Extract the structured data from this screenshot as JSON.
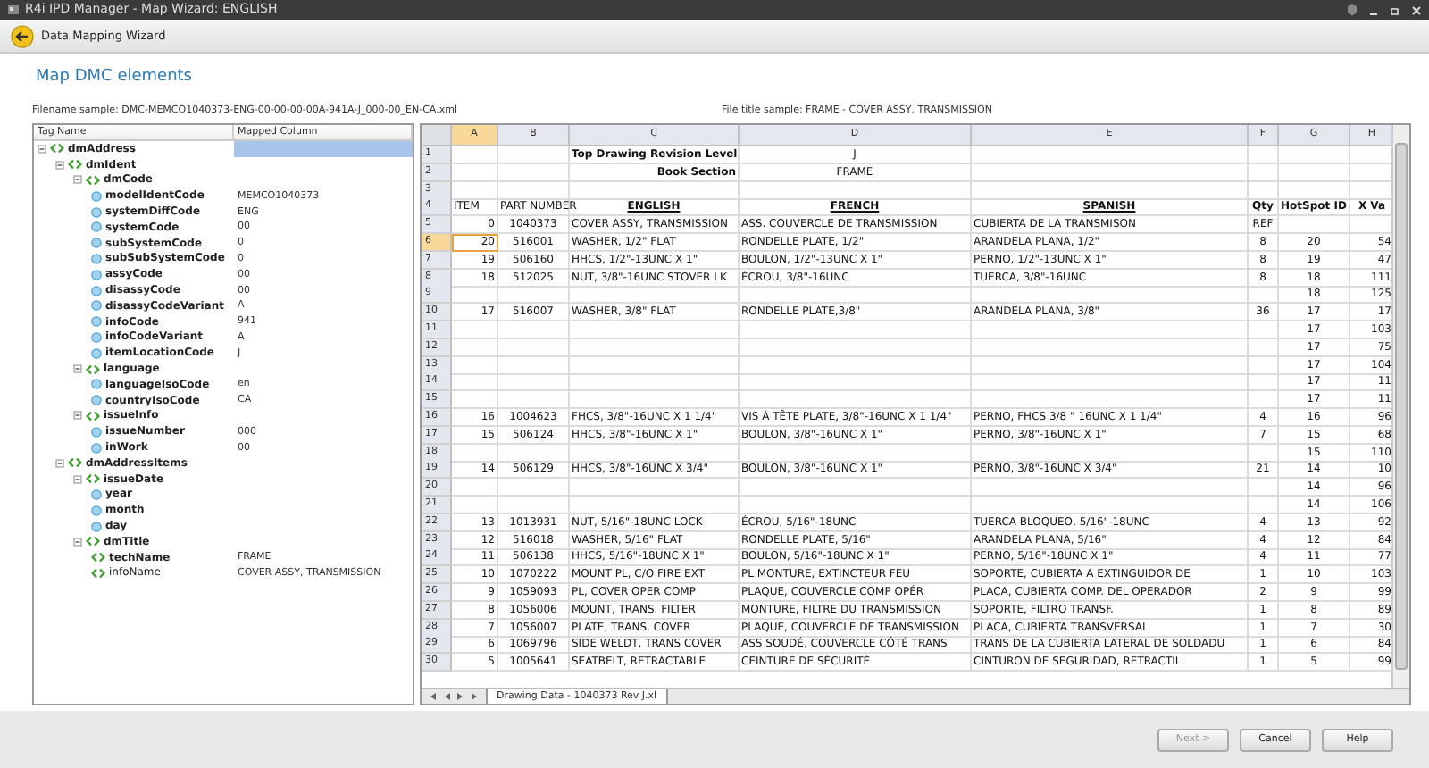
{
  "window": {
    "title": "R4i IPD Manager - Map Wizard: ENGLISH"
  },
  "toolbar": {
    "title": "Data Mapping Wizard"
  },
  "heading": "Map DMC elements",
  "filename_sample": "Filename sample: DMC-MEMCO1040373-ENG-00-00-00-00A-941A-J_000-00_EN-CA.xml",
  "file_title_sample": "File title sample: FRAME - COVER ASSY, TRANSMISSION",
  "tree": {
    "columns": [
      "Tag Name",
      "Mapped Column"
    ],
    "nodes": [
      {
        "name": "dmAddress",
        "kind": "element",
        "selected": true,
        "expanded": true,
        "children": [
          {
            "name": "dmIdent",
            "kind": "element",
            "selected": false,
            "expanded": true,
            "children": [
              {
                "name": "dmCode",
                "kind": "element",
                "selected": false,
                "expanded": true,
                "children": [
                  {
                    "name": "modelIdentCode",
                    "kind": "attribute",
                    "value": "MEMCO1040373",
                    "selected": false
                  },
                  {
                    "name": "systemDiffCode",
                    "kind": "attribute",
                    "value": "ENG",
                    "selected": false
                  },
                  {
                    "name": "systemCode",
                    "kind": "attribute",
                    "value": "00",
                    "selected": false
                  },
                  {
                    "name": "subSystemCode",
                    "kind": "attribute",
                    "value": "0",
                    "selected": false
                  },
                  {
                    "name": "subSubSystemCode",
                    "kind": "attribute",
                    "value": "0",
                    "selected": false
                  },
                  {
                    "name": "assyCode",
                    "kind": "attribute",
                    "value": "00",
                    "selected": false
                  },
                  {
                    "name": "disassyCode",
                    "kind": "attribute",
                    "value": "00",
                    "selected": false
                  },
                  {
                    "name": "disassyCodeVariant",
                    "kind": "attribute",
                    "value": "A",
                    "selected": false
                  },
                  {
                    "name": "infoCode",
                    "kind": "attribute",
                    "value": "941",
                    "selected": false
                  },
                  {
                    "name": "infoCodeVariant",
                    "kind": "attribute",
                    "value": "A",
                    "selected": false
                  },
                  {
                    "name": "itemLocationCode",
                    "kind": "attribute",
                    "value": "J",
                    "selected": false
                  }
                ]
              },
              {
                "name": "language",
                "kind": "element",
                "selected": false,
                "expanded": true,
                "children": [
                  {
                    "name": "languageIsoCode",
                    "kind": "attribute",
                    "value": "en",
                    "selected": false
                  },
                  {
                    "name": "countryIsoCode",
                    "kind": "attribute",
                    "value": "CA",
                    "selected": false
                  }
                ]
              },
              {
                "name": "issueInfo",
                "kind": "element",
                "selected": false,
                "expanded": true,
                "children": [
                  {
                    "name": "issueNumber",
                    "kind": "attribute",
                    "value": "000",
                    "selected": false
                  },
                  {
                    "name": "inWork",
                    "kind": "attribute",
                    "value": "00",
                    "selected": false
                  }
                ]
              }
            ]
          },
          {
            "name": "dmAddressItems",
            "kind": "element",
            "selected": false,
            "expanded": true,
            "children": [
              {
                "name": "issueDate",
                "kind": "element",
                "selected": false,
                "expanded": true,
                "children": [
                  {
                    "name": "year",
                    "kind": "attribute",
                    "selected": false
                  },
                  {
                    "name": "month",
                    "kind": "attribute",
                    "selected": false
                  },
                  {
                    "name": "day",
                    "kind": "attribute",
                    "selected": false
                  }
                ]
              },
              {
                "name": "dmTitle",
                "kind": "element",
                "selected": false,
                "expanded": true,
                "children": [
                  {
                    "name": "techName",
                    "kind": "element",
                    "value": "FRAME",
                    "selected": false
                  },
                  {
                    "name": "infoName",
                    "kind": "element",
                    "value": "COVER ASSY, TRANSMISSION",
                    "bold": false,
                    "selected": false
                  }
                ]
              }
            ]
          }
        ]
      }
    ]
  },
  "sheet": {
    "columns": [
      {
        "label": "A",
        "selected": true
      },
      {
        "label": "B",
        "selected": false
      },
      {
        "label": "C",
        "selected": false
      },
      {
        "label": "D",
        "selected": false
      },
      {
        "label": "E",
        "selected": false
      },
      {
        "label": "F",
        "selected": false
      },
      {
        "label": "G",
        "selected": false
      },
      {
        "label": "H",
        "selected": false
      }
    ],
    "rows": [
      {
        "number": "1",
        "kind": "title",
        "selected": false,
        "cells": [
          "",
          "",
          "Top Drawing Revision Level",
          "J",
          "",
          "",
          "",
          ""
        ]
      },
      {
        "number": "2",
        "kind": "title",
        "selected": false,
        "cells": [
          "",
          "",
          "Book Section",
          "FRAME",
          "",
          "",
          "",
          ""
        ]
      },
      {
        "number": "3",
        "kind": "data",
        "selected": false,
        "cells": [
          "",
          "",
          "",
          "",
          "",
          "",
          "",
          ""
        ]
      },
      {
        "number": "4",
        "kind": "heading",
        "selected": false,
        "cells": [
          "ITEM",
          "PART NUMBER",
          "ENGLISH",
          "FRENCH",
          "SPANISH",
          "Qty",
          "HotSpot ID",
          "X Va"
        ]
      },
      {
        "number": "5",
        "kind": "data",
        "selected": false,
        "cells": [
          "0",
          "1040373",
          "COVER ASSY, TRANSMISSION",
          "ASS. COUVERCLE DE TRANSMISSION",
          "CUBIERTA DE LA TRANSMISON",
          "REF",
          "",
          ""
        ]
      },
      {
        "number": "6",
        "kind": "data",
        "selected": true,
        "cells": [
          "20",
          "516001",
          "WASHER, 1/2\" FLAT",
          "RONDELLE PLATE, 1/2\"",
          "ARANDELA PLANA, 1/2\"",
          "8",
          "20",
          "54"
        ]
      },
      {
        "number": "7",
        "kind": "data",
        "selected": false,
        "cells": [
          "19",
          "506160",
          "HHCS, 1/2\"-13UNC X 1\"",
          "BOULON, 1/2\"-13UNC X 1\"",
          "PERNO, 1/2\"-13UNC X 1\"",
          "8",
          "19",
          "47"
        ]
      },
      {
        "number": "8",
        "kind": "data",
        "selected": false,
        "cells": [
          "18",
          "512025",
          "NUT, 3/8\"-16UNC STOVER LK",
          "ÉCROU, 3/8\"-16UNC",
          "TUERCA, 3/8\"-16UNC",
          "8",
          "18",
          "111"
        ]
      },
      {
        "number": "9",
        "kind": "data",
        "selected": false,
        "cells": [
          "",
          "",
          "",
          "",
          "",
          "",
          "18",
          "125"
        ]
      },
      {
        "number": "10",
        "kind": "data",
        "selected": false,
        "cells": [
          "17",
          "516007",
          "WASHER, 3/8\" FLAT",
          "RONDELLE PLATE,3/8\"",
          "ARANDELA PLANA, 3/8\"",
          "36",
          "17",
          "17"
        ]
      },
      {
        "number": "11",
        "kind": "data",
        "selected": false,
        "cells": [
          "",
          "",
          "",
          "",
          "",
          "",
          "17",
          "103"
        ]
      },
      {
        "number": "12",
        "kind": "data",
        "selected": false,
        "cells": [
          "",
          "",
          "",
          "",
          "",
          "",
          "17",
          "75"
        ]
      },
      {
        "number": "13",
        "kind": "data",
        "selected": false,
        "cells": [
          "",
          "",
          "",
          "",
          "",
          "",
          "17",
          "104"
        ]
      },
      {
        "number": "14",
        "kind": "data",
        "selected": false,
        "cells": [
          "",
          "",
          "",
          "",
          "",
          "",
          "17",
          "11"
        ]
      },
      {
        "number": "15",
        "kind": "data",
        "selected": false,
        "cells": [
          "",
          "",
          "",
          "",
          "",
          "",
          "17",
          "11"
        ]
      },
      {
        "number": "16",
        "kind": "data",
        "selected": false,
        "cells": [
          "16",
          "1004623",
          "FHCS, 3/8\"-16UNC X 1 1/4\"",
          "VIS À TÊTE PLATE, 3/8\"-16UNC X 1 1/4\"",
          "PERNO, FHCS 3/8 \" 16UNC X 1 1/4\"",
          "4",
          "16",
          "96"
        ]
      },
      {
        "number": "17",
        "kind": "data",
        "selected": false,
        "cells": [
          "15",
          "506124",
          "HHCS, 3/8\"-16UNC X 1\"",
          "BOULON, 3/8\"-16UNC X 1\"",
          "PERNO, 3/8\"-16UNC X 1\"",
          "7",
          "15",
          "68"
        ]
      },
      {
        "number": "18",
        "kind": "data",
        "selected": false,
        "cells": [
          "",
          "",
          "",
          "",
          "",
          "",
          "15",
          "110"
        ]
      },
      {
        "number": "19",
        "kind": "data",
        "selected": false,
        "cells": [
          "14",
          "506129",
          "HHCS, 3/8\"-16UNC X 3/4\"",
          "BOULON, 3/8\"-16UNC X 1\"",
          "PERNO, 3/8\"-16UNC X 3/4\"",
          "21",
          "14",
          "10"
        ]
      },
      {
        "number": "20",
        "kind": "data",
        "selected": false,
        "cells": [
          "",
          "",
          "",
          "",
          "",
          "",
          "14",
          "96"
        ]
      },
      {
        "number": "21",
        "kind": "data",
        "selected": false,
        "cells": [
          "",
          "",
          "",
          "",
          "",
          "",
          "14",
          "106"
        ]
      },
      {
        "number": "22",
        "kind": "data",
        "selected": false,
        "cells": [
          "13",
          "1013931",
          "NUT, 5/16\"-18UNC LOCK",
          "ÉCROU, 5/16\"-18UNC",
          "TUERCA BLOQUEO, 5/16\"-18UNC",
          "4",
          "13",
          "92"
        ]
      },
      {
        "number": "23",
        "kind": "data",
        "selected": false,
        "cells": [
          "12",
          "516018",
          "WASHER, 5/16\" FLAT",
          "RONDELLE PLATE, 5/16\"",
          "ARANDELA PLANA, 5/16\"",
          "4",
          "12",
          "84"
        ]
      },
      {
        "number": "24",
        "kind": "data",
        "selected": false,
        "cells": [
          "11",
          "506138",
          "HHCS, 5/16\"-18UNC X 1\"",
          "BOULON, 5/16\"-18UNC X 1\"",
          "PERNO, 5/16\"-18UNC X 1\"",
          "4",
          "11",
          "77"
        ]
      },
      {
        "number": "25",
        "kind": "data",
        "selected": false,
        "cells": [
          "10",
          "1070222",
          "MOUNT PL, C/O FIRE EXT",
          "PL MONTURE, EXTINCTEUR FEU",
          "SOPORTE, CUBIERTA A EXTINGUIDOR DE",
          "1",
          "10",
          "103"
        ]
      },
      {
        "number": "26",
        "kind": "data",
        "selected": false,
        "cells": [
          "9",
          "1059093",
          "PL, COVER OPER COMP",
          "PLAQUE, COUVERCLE COMP OPÉR",
          "PLACA, CUBIERTA COMP. DEL OPERADOR",
          "2",
          "9",
          "99"
        ]
      },
      {
        "number": "27",
        "kind": "data",
        "selected": false,
        "cells": [
          "8",
          "1056006",
          "MOUNT, TRANS. FILTER",
          "MONTURE, FILTRE DU TRANSMISSION",
          "SOPORTE, FILTRO TRANSF.",
          "1",
          "8",
          "89"
        ]
      },
      {
        "number": "28",
        "kind": "data",
        "selected": false,
        "cells": [
          "7",
          "1056007",
          "PLATE, TRANS. COVER",
          "PLAQUE, COUVERCLE DE TRANSMISSION",
          "PLACA, CUBIERTA TRANSVERSAL",
          "1",
          "7",
          "30"
        ]
      },
      {
        "number": "29",
        "kind": "data",
        "selected": false,
        "cells": [
          "6",
          "1069796",
          "SIDE WELDT, TRANS COVER",
          "ASS SOUDÉ, COUVERCLE CÔTÉ TRANS",
          "TRANS DE LA CUBIERTA LATERAL DE SOLDADU",
          "1",
          "6",
          "84"
        ]
      },
      {
        "number": "30",
        "kind": "data",
        "selected": false,
        "cells": [
          "5",
          "1005641",
          "SEATBELT, RETRACTABLE",
          "CEINTURE DE SÉCURITÉ",
          "CINTURON DE SEGURIDAD, RETRACTIL",
          "1",
          "5",
          "99"
        ]
      }
    ],
    "sheet_tab": "Drawing Data - 1040373 Rev J.xl"
  },
  "buttons": [
    {
      "label": "Next >",
      "disabled": true
    },
    {
      "label": "Cancel",
      "disabled": false
    },
    {
      "label": "Help",
      "disabled": false
    }
  ]
}
